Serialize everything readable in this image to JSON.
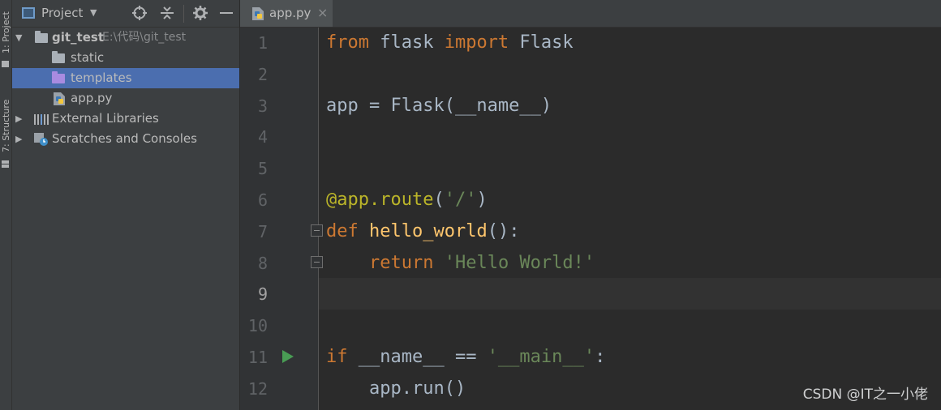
{
  "tool_strip": {
    "project_tab": "1: Project",
    "structure_tab": "7: Structure"
  },
  "project_panel": {
    "title": "Project",
    "icons": [
      "locate-icon",
      "collapse-icon",
      "gear-icon",
      "minimize-icon"
    ],
    "tree": [
      {
        "label": "git_test",
        "detail": "E:\\代码\\git_test",
        "icon": "folder-icon",
        "expanded": true
      },
      {
        "label": "static",
        "icon": "folder-icon"
      },
      {
        "label": "templates",
        "icon": "folder-icon",
        "selected": true
      },
      {
        "label": "app.py",
        "icon": "python-file-icon"
      },
      {
        "label": "External Libraries",
        "icon": "library-icon",
        "expanded": false
      },
      {
        "label": "Scratches and Consoles",
        "icon": "scratch-icon",
        "expanded": false
      }
    ]
  },
  "editor": {
    "tab": {
      "label": "app.py",
      "close": "×"
    },
    "current_line": 9,
    "line_numbers": [
      "1",
      "2",
      "3",
      "4",
      "5",
      "6",
      "7",
      "8",
      "9",
      "10",
      "11",
      "12"
    ],
    "code_lines": [
      "from flask import Flask",
      "",
      "app = Flask(__name__)",
      "",
      "",
      "@app.route('/')",
      "def hello_world():",
      "    return 'Hello World!'",
      "",
      "",
      "if __name__ == '__main__':",
      "    app.run()"
    ],
    "run_gutter_line": 11
  },
  "watermark": "CSDN @IT之一小佬",
  "colors": {
    "background": "#2b2b2b",
    "panel": "#3c3f41",
    "selection": "#4b6eaf",
    "keyword": "#cc7832",
    "function": "#ffc66d",
    "string": "#6a8759",
    "decorator": "#bbb529",
    "text": "#a9b7c6",
    "run_icon": "#499c54"
  }
}
